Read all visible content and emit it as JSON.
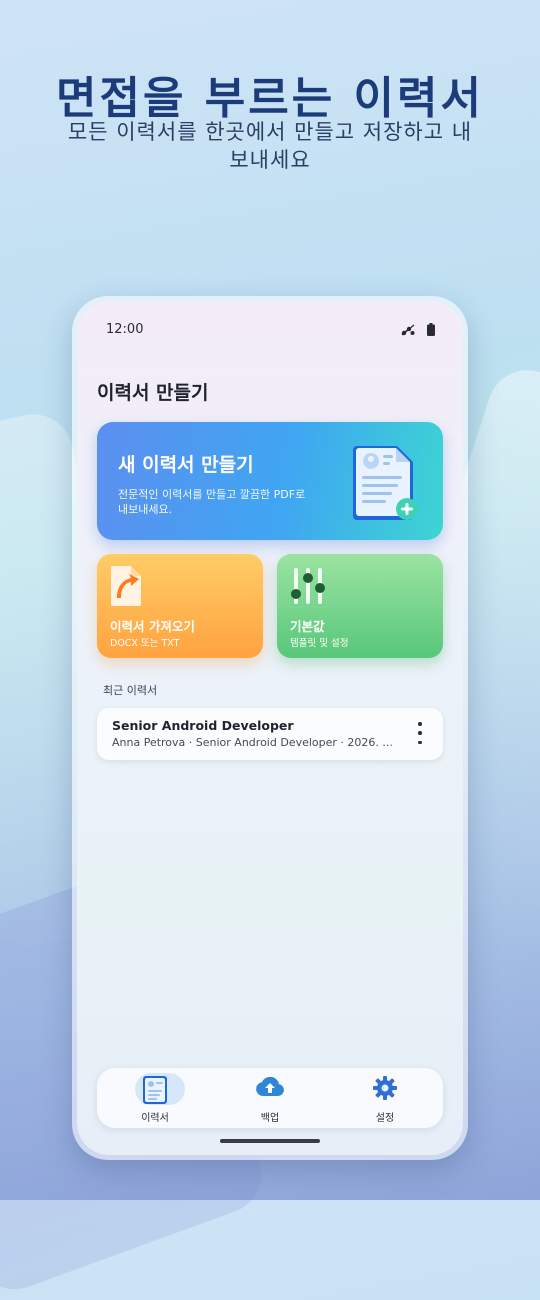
{
  "hero": {
    "title": "면접을 부르는 이력서",
    "subtitle": "모든 이력서를 한곳에서 만들고 저장하고 내보내세요"
  },
  "status_bar": {
    "time": "12:00",
    "icons": [
      "signal-icon",
      "battery-icon"
    ]
  },
  "screen": {
    "title": "이력서 만들기",
    "new_resume_card": {
      "title": "새 이력서 만들기",
      "subtitle": "전문적인 이력서를 만들고 깔끔한 PDF로 내보내세요.",
      "icon": "document-add-icon"
    },
    "import_card": {
      "title": "이력서 가져오기",
      "subtitle": "DOCX 또는 TXT",
      "icon": "import-document-icon"
    },
    "defaults_card": {
      "title": "기본값",
      "subtitle": "템플릿 및 설정",
      "icon": "sliders-icon"
    },
    "recent_label": "최근 이력서",
    "recent_resumes": [
      {
        "title": "Senior Android Developer",
        "subtitle": "Anna Petrova · Senior Android Developer · 2026. ..."
      }
    ]
  },
  "bottom_nav": {
    "items": [
      {
        "label": "이력서",
        "icon": "resume-icon",
        "active": true
      },
      {
        "label": "백업",
        "icon": "cloud-upload-icon",
        "active": false
      },
      {
        "label": "설정",
        "icon": "gear-icon",
        "active": false
      }
    ]
  },
  "colors": {
    "hero_title": "#1c3b7a",
    "new_card_start": "#5c8ff0",
    "new_card_end": "#3dd5d3",
    "import_card": "#ffa340",
    "defaults_card": "#58c779"
  }
}
